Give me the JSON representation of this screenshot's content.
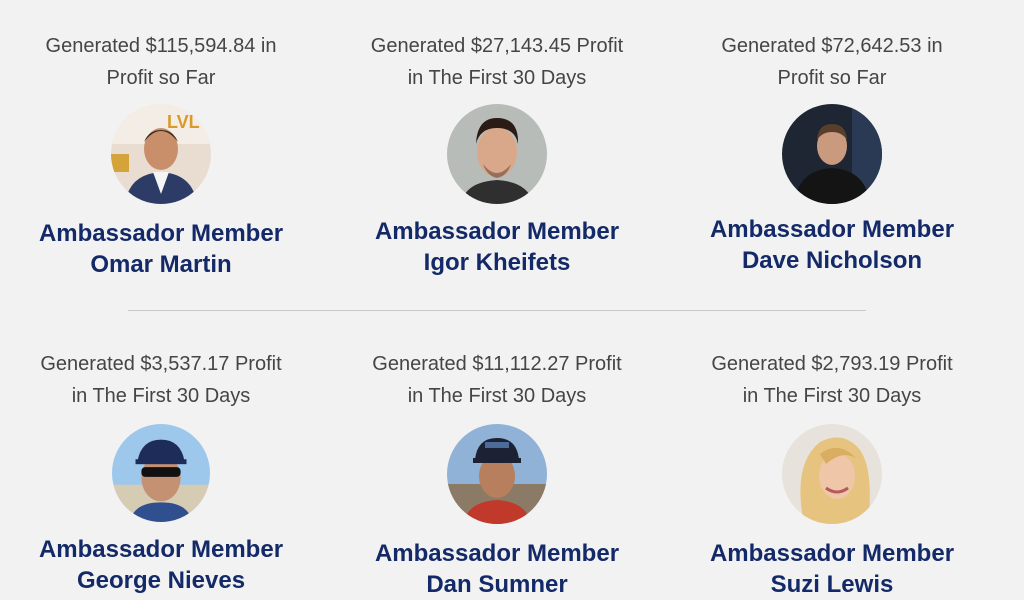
{
  "members": [
    {
      "profit_line1": "Generated $115,594.84 in",
      "profit_line2": "Profit so Far",
      "title": "Ambassador Member",
      "name": "Omar Martin",
      "avatar": "avatar-omar-martin"
    },
    {
      "profit_line1": "Generated $27,143.45 Profit",
      "profit_line2": "in The First 30 Days",
      "title": "Ambassador Member",
      "name": "Igor Kheifets",
      "avatar": "avatar-igor-kheifets"
    },
    {
      "profit_line1": "Generated $72,642.53 in",
      "profit_line2": "Profit so Far",
      "title": "Ambassador Member",
      "name": "Dave Nicholson",
      "avatar": "avatar-dave-nicholson"
    },
    {
      "profit_line1": "Generated $3,537.17 Profit",
      "profit_line2": "in The First 30 Days",
      "title": "Ambassador Member",
      "name": "George Nieves",
      "avatar": "avatar-george-nieves"
    },
    {
      "profit_line1": "Generated $11,112.27 Profit",
      "profit_line2": "in The First 30 Days",
      "title": "Ambassador Member",
      "name": "Dan Sumner",
      "avatar": "avatar-dan-sumner"
    },
    {
      "profit_line1": "Generated $2,793.19 Profit",
      "profit_line2": "in The First 30 Days",
      "title": "Ambassador Member",
      "name": "Suzi Lewis",
      "avatar": "avatar-suzi-lewis"
    }
  ],
  "colors": {
    "background": "#f2f2f2",
    "heading": "#142a68",
    "text": "#454545",
    "divider": "#c8c8c8"
  }
}
